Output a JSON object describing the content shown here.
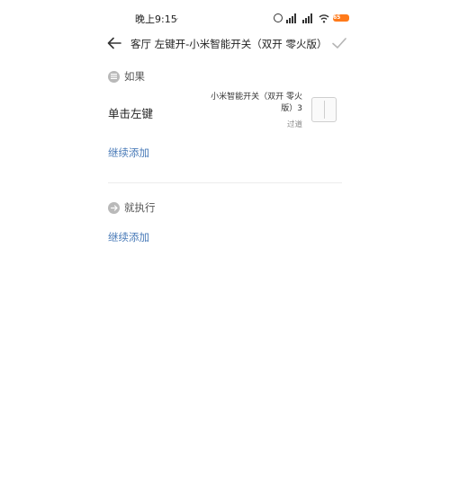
{
  "status_bar": {
    "time": "晚上9:15",
    "icons": [
      "alarm-icon",
      "signal-icon",
      "signal-icon",
      "wifi-icon",
      "battery-icon"
    ],
    "battery_text": "65"
  },
  "header": {
    "title": "客厅 左键开-小米智能开关（双开 零火版） ...",
    "back_icon": "back-arrow-icon",
    "confirm_icon": "check-icon"
  },
  "if_section": {
    "label": "如果",
    "condition": {
      "name": "单击左键",
      "device": "小米智能开关（双开 零火版）3",
      "room": "过道"
    },
    "add_more": "继续添加"
  },
  "then_section": {
    "label": "就执行",
    "add_more": "继续添加"
  },
  "colors": {
    "link": "#4a7bb8",
    "badge": "#b9b9b9",
    "battery": "#ff7a1a"
  }
}
